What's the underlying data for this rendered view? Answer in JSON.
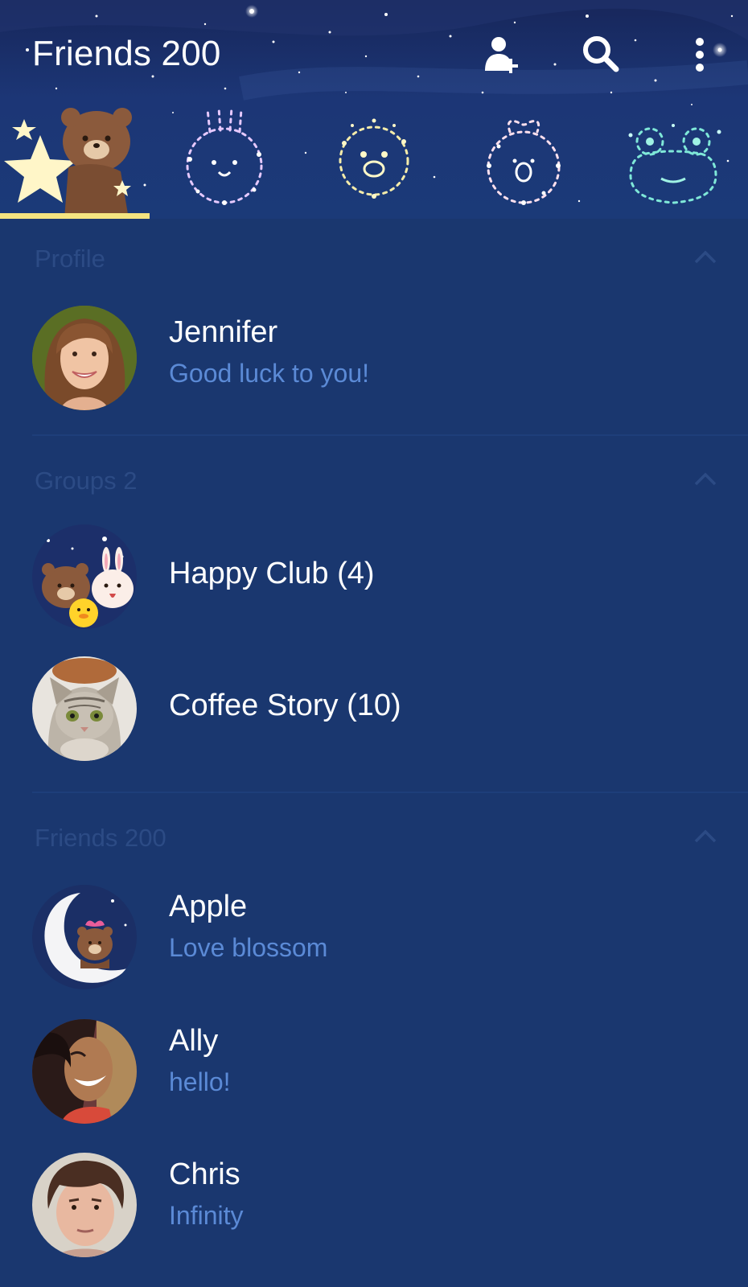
{
  "app_bar": {
    "title": "Friends 200",
    "icons": [
      "add-friend-icon",
      "search-icon",
      "more-vert-icon"
    ]
  },
  "tabs": [
    {
      "name": "brown-bear-star",
      "selected": true
    },
    {
      "name": "cony-rabbit-constellation",
      "selected": false
    },
    {
      "name": "sally-chick-constellation",
      "selected": false
    },
    {
      "name": "choco-bear-constellation",
      "selected": false
    },
    {
      "name": "leonard-frog-constellation",
      "selected": false
    }
  ],
  "colors": {
    "background": "#1a376f",
    "section_title": "#2c4b85",
    "status_text": "#5b8ad6",
    "tab_indicator": "#f5e480"
  },
  "sections": {
    "profile": {
      "title": "Profile",
      "items": [
        {
          "name": "Jennifer",
          "status": "Good luck to you!"
        }
      ]
    },
    "groups": {
      "title": "Groups 2",
      "items": [
        {
          "name": "Happy Club (4)"
        },
        {
          "name": "Coffee Story (10)"
        }
      ]
    },
    "friends": {
      "title": "Friends 200",
      "items": [
        {
          "name": "Apple",
          "status": "Love blossom"
        },
        {
          "name": "Ally",
          "status": "hello!"
        },
        {
          "name": "Chris",
          "status": "Infinity"
        }
      ]
    }
  }
}
